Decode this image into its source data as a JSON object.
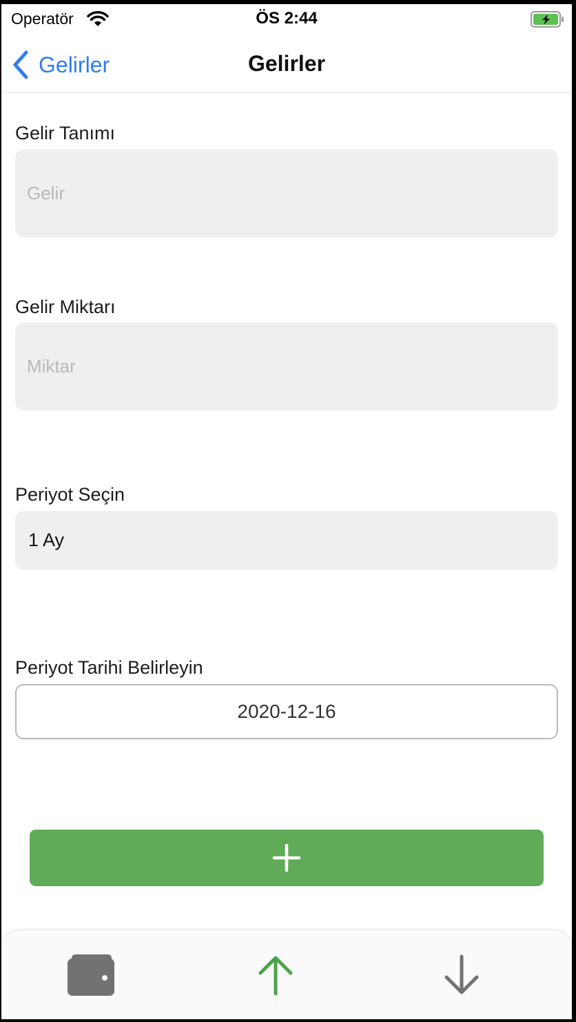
{
  "status_bar": {
    "carrier": "Operatör",
    "time": "ÖS 2:44",
    "icons": [
      "wifi-icon",
      "battery-charging-icon"
    ]
  },
  "nav": {
    "back_label": "Gelirler",
    "title": "Gelirler"
  },
  "form": {
    "income_name": {
      "label": "Gelir Tanımı",
      "placeholder": "Gelir",
      "value": ""
    },
    "income_amount": {
      "label": "Gelir Miktarı",
      "placeholder": "Miktar",
      "value": ""
    },
    "period": {
      "label": "Periyot Seçin",
      "selected": "1 Ay"
    },
    "period_date": {
      "label": "Periyot Tarihi Belirleyin",
      "value": "2020-12-16"
    }
  },
  "add_button": {
    "icon": "plus-icon"
  },
  "tab_bar": {
    "tabs": [
      {
        "icon": "wallet-icon",
        "active": false
      },
      {
        "icon": "arrow-up-icon",
        "active": true
      },
      {
        "icon": "arrow-down-icon",
        "active": false
      }
    ]
  },
  "colors": {
    "accent_blue": "#2f7cf6",
    "add_button_green": "#5fab57",
    "active_tab_green": "#4da34a",
    "inactive_tab_gray": "#727272",
    "battery_green": "#5cc152"
  }
}
